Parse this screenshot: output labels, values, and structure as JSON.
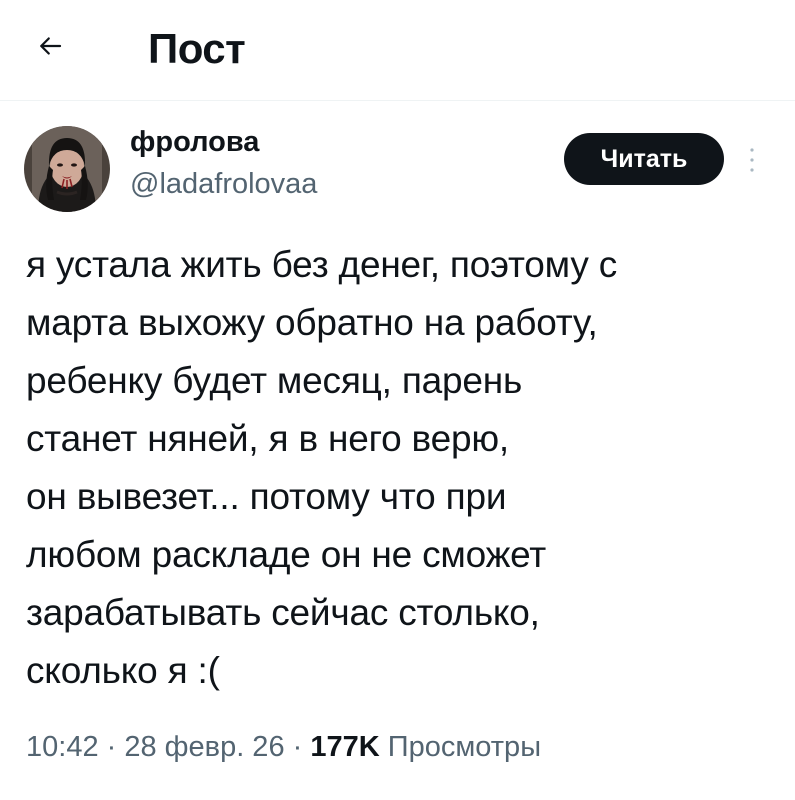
{
  "header": {
    "title": "Пост"
  },
  "author": {
    "display_name": "фролова",
    "handle": "@ladafrolovaa"
  },
  "actions": {
    "follow_label": "Читать"
  },
  "tweet": {
    "text": "я устала жить без денег, поэтому с\nмарта выхожу обратно на работу,\nребенку будет месяц, парень\nстанет няней, я в него верю,\nон вывезет... потому что при\nлюбом раскладе он не сможет\nзарабатывать сейчас столько,\nсколько я :("
  },
  "meta": {
    "time": "10:42",
    "separator": " · ",
    "date": "28 февр. 26",
    "views_count": "177K",
    "views_label": "Просмотры"
  },
  "icons": {
    "back": "arrow-left-icon",
    "more": "more-vertical-icon"
  },
  "colors": {
    "text": "#0f1419",
    "secondary": "#536471",
    "button": "#0f1419",
    "divider": "#eff3f4"
  }
}
